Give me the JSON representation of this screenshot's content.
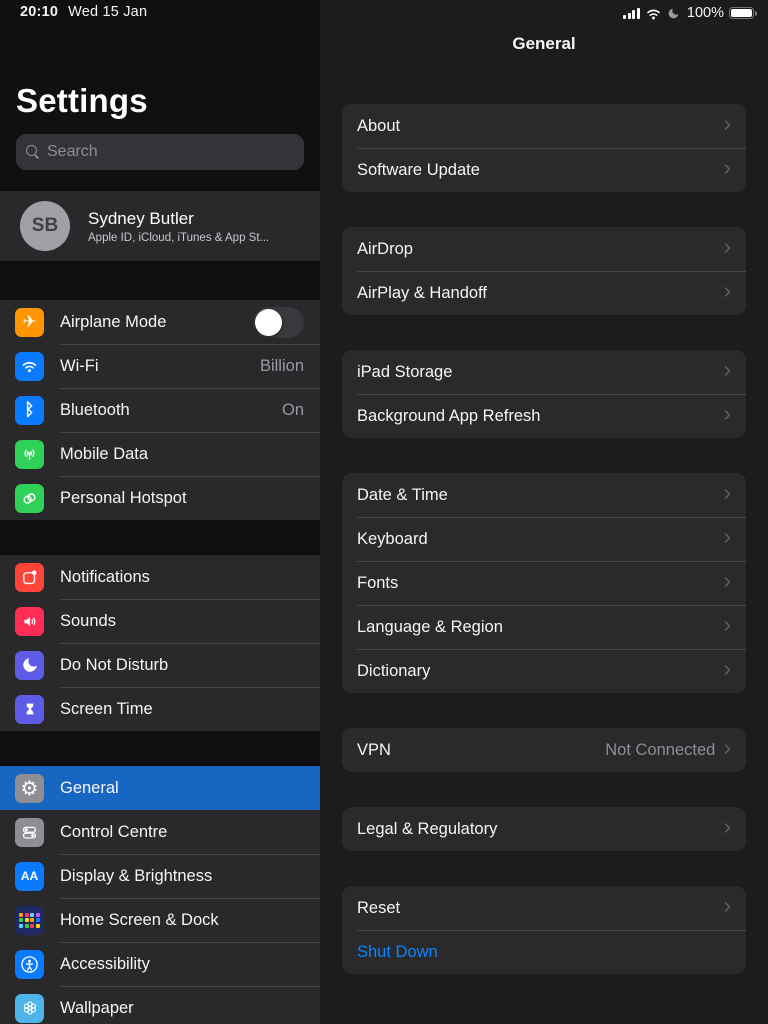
{
  "status_bar": {
    "time": "20:10",
    "date": "Wed 15 Jan",
    "battery_percent": "100%",
    "icons": [
      "cellular-signal-icon",
      "wifi-icon",
      "moon-icon",
      "battery-icon"
    ]
  },
  "sidebar": {
    "title": "Settings",
    "search": {
      "placeholder": "Search"
    },
    "profile": {
      "initials": "SB",
      "name": "Sydney Butler",
      "subtitle": "Apple ID, iCloud, iTunes & App St..."
    },
    "groups": [
      {
        "items": [
          {
            "label": "Airplane Mode",
            "icon": "airplane-icon",
            "control": "toggle",
            "toggle_state": "off"
          },
          {
            "label": "Wi-Fi",
            "icon": "wifi-icon",
            "value": "Billion"
          },
          {
            "label": "Bluetooth",
            "icon": "bluetooth-icon",
            "value": "On"
          },
          {
            "label": "Mobile Data",
            "icon": "mobile-data-antenna-icon"
          },
          {
            "label": "Personal Hotspot",
            "icon": "hotspot-links-icon"
          }
        ]
      },
      {
        "items": [
          {
            "label": "Notifications",
            "icon": "notifications-icon"
          },
          {
            "label": "Sounds",
            "icon": "speaker-icon"
          },
          {
            "label": "Do Not Disturb",
            "icon": "moon-icon"
          },
          {
            "label": "Screen Time",
            "icon": "hourglass-icon"
          }
        ]
      },
      {
        "items": [
          {
            "label": "General",
            "icon": "gear-icon",
            "selected": true
          },
          {
            "label": "Control Centre",
            "icon": "toggles-icon"
          },
          {
            "label": "Display & Brightness",
            "icon": "text-size-icon"
          },
          {
            "label": "Home Screen & Dock",
            "icon": "app-grid-icon"
          },
          {
            "label": "Accessibility",
            "icon": "accessibility-figure-icon"
          },
          {
            "label": "Wallpaper",
            "icon": "flower-icon"
          }
        ]
      }
    ]
  },
  "detail": {
    "title": "General",
    "groups": [
      {
        "items": [
          {
            "label": "About"
          },
          {
            "label": "Software Update"
          }
        ]
      },
      {
        "items": [
          {
            "label": "AirDrop"
          },
          {
            "label": "AirPlay & Handoff"
          }
        ]
      },
      {
        "items": [
          {
            "label": "iPad Storage"
          },
          {
            "label": "Background App Refresh"
          }
        ]
      },
      {
        "items": [
          {
            "label": "Date & Time"
          },
          {
            "label": "Keyboard"
          },
          {
            "label": "Fonts"
          },
          {
            "label": "Language & Region"
          },
          {
            "label": "Dictionary"
          }
        ]
      },
      {
        "items": [
          {
            "label": "VPN",
            "value": "Not Connected"
          }
        ]
      },
      {
        "items": [
          {
            "label": "Legal & Regulatory"
          }
        ]
      },
      {
        "items": [
          {
            "label": "Reset"
          },
          {
            "label": "Shut Down",
            "style": "link"
          }
        ]
      }
    ]
  },
  "colors": {
    "selected_row_blue": "#1766c2",
    "link_blue": "#0a84ff",
    "card_background": "#2a2a2d",
    "panel_background": "#1c1c1f",
    "muted_text": "#8e8e93"
  }
}
